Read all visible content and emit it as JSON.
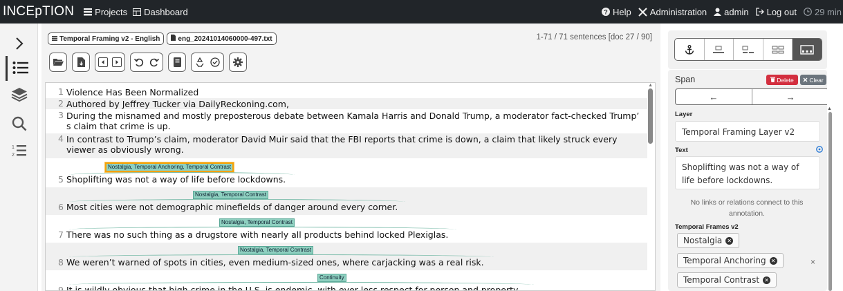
{
  "nav": {
    "brand": "INCEpTION",
    "projects": "Projects",
    "dashboard": "Dashboard",
    "help": "Help",
    "administration": "Administration",
    "user": "admin",
    "logout": "Log out",
    "timer": "29 min"
  },
  "breadcrumb": {
    "project": "Temporal Framing v2 - English",
    "document": "eng_20241014060000-497.txt"
  },
  "sentence_info": "1-71 / 71 sentences [doc 27 / 90]",
  "lines": [
    {
      "num": "1",
      "text": "Violence Has Been Normalized"
    },
    {
      "num": "2",
      "text": "Authored by Jeffrey Tucker via DailyReckoning.com,"
    },
    {
      "num": "3",
      "text": "During the misnamed and mostly preposterous debate between Kamala Harris and Donald Trump, a moderator fact-checked Trump’",
      "cont": "s claim that crime is up."
    },
    {
      "num": "4",
      "text": "In contrast to Trump’s claim, moderator David Muir said that the FBI reports that crime is down, a claim that likely struck every",
      "cont": " viewer as obviously wrong."
    },
    {
      "num": "5",
      "text": "Shoplifting was not a way of life before lockdowns.",
      "label": "Nostalgia, Temporal Anchoring, Temporal Contrast"
    },
    {
      "num": "6",
      "text": "Most cities were not demographic minefields of danger around every corner.",
      "label": "Nostalgia, Temporal Contrast"
    },
    {
      "num": "7",
      "text": "There was no such thing as a drugstore with nearly all products behind locked Plexiglas.",
      "label": "Nostalgia, Temporal Contrast"
    },
    {
      "num": "8",
      "text": "We weren’t warned of spots in cities, even medium-sized ones, where carjacking was a real risk.",
      "label": "Nostalgia, Temporal Contrast"
    },
    {
      "num": "9",
      "text": "It is wildly obvious that high crime in the U.S. is endemic, with ever less respect for person and property.",
      "label": "Continuity"
    }
  ],
  "detail": {
    "title": "Span",
    "delete": "Delete",
    "clear": "Clear",
    "prev_arrow": "←",
    "next_arrow": "→",
    "layer_label": "Layer",
    "layer_value": "Temporal Framing Layer v2",
    "text_label": "Text",
    "text_value": "Shoplifting was not a way of life before lockdowns.",
    "no_links": "No links or relations connect to this annotation.",
    "frames_label": "Temporal Frames v2",
    "frames": [
      "Nostalgia",
      "Temporal Anchoring",
      "Temporal Contrast"
    ],
    "clear_x": "×"
  }
}
